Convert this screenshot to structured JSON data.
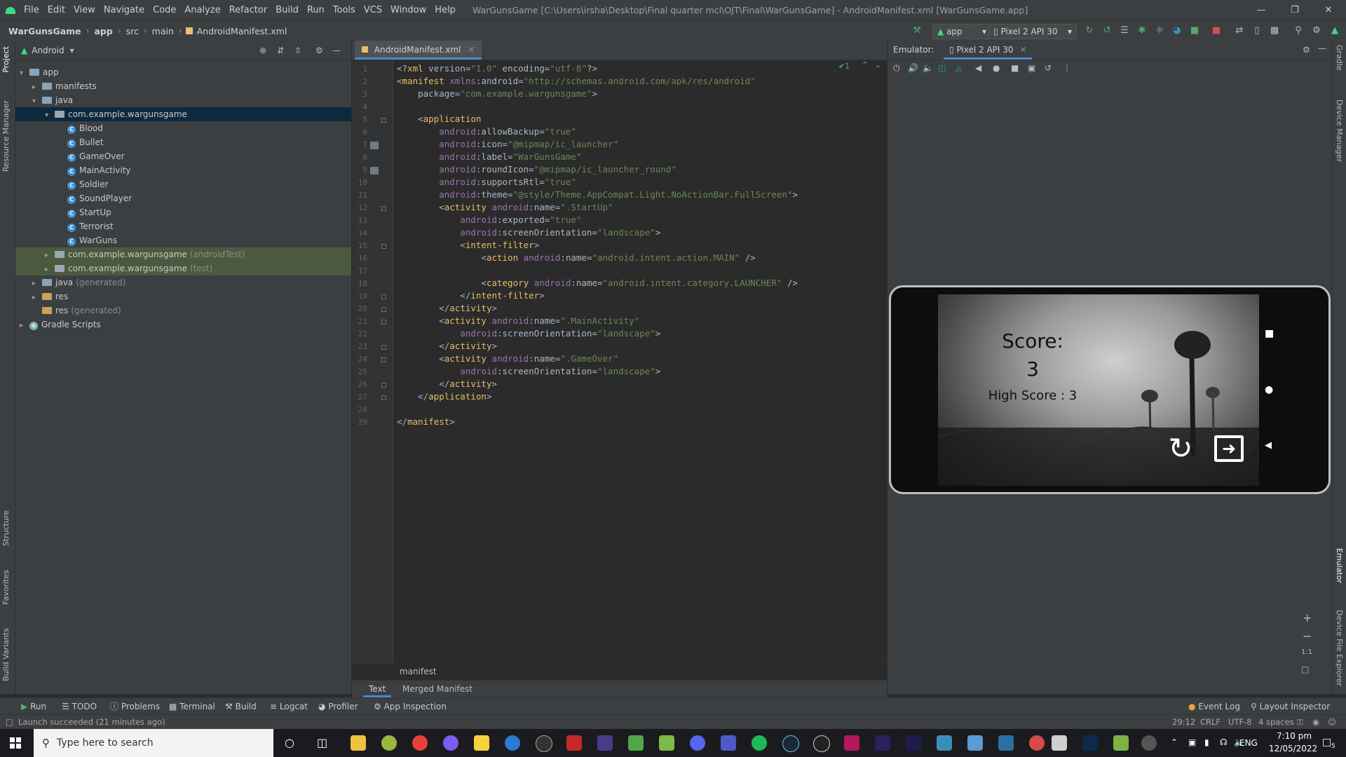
{
  "menu": [
    "File",
    "Edit",
    "View",
    "Navigate",
    "Code",
    "Analyze",
    "Refactor",
    "Build",
    "Run",
    "Tools",
    "VCS",
    "Window",
    "Help"
  ],
  "window_title": "WarGunsGame [C:\\Users\\irsha\\Desktop\\Final quarter mcl\\OJT\\Final\\WarGunsGame] - AndroidManifest.xml [WarGunsGame.app]",
  "breadcrumb": [
    "WarGunsGame",
    "app",
    "src",
    "main",
    "AndroidManifest.xml"
  ],
  "toolbar": {
    "config": "app",
    "device": "Pixel 2 API 30"
  },
  "project": {
    "view": "Android",
    "tree": [
      {
        "label": "app",
        "note": "",
        "depth": 0,
        "kind": "folder",
        "arrow": "▾"
      },
      {
        "label": "manifests",
        "note": "",
        "depth": 1,
        "kind": "folder",
        "arrow": "▸"
      },
      {
        "label": "java",
        "note": "",
        "depth": 1,
        "kind": "folder",
        "arrow": "▾"
      },
      {
        "label": "com.example.wargunsgame",
        "note": "",
        "depth": 2,
        "kind": "pkg",
        "arrow": "▾",
        "selected": true
      },
      {
        "label": "Blood",
        "note": "",
        "depth": 3,
        "kind": "class",
        "arrow": ""
      },
      {
        "label": "Bullet",
        "note": "",
        "depth": 3,
        "kind": "class",
        "arrow": ""
      },
      {
        "label": "GameOver",
        "note": "",
        "depth": 3,
        "kind": "class",
        "arrow": ""
      },
      {
        "label": "MainActivity",
        "note": "",
        "depth": 3,
        "kind": "class",
        "arrow": ""
      },
      {
        "label": "Soldier",
        "note": "",
        "depth": 3,
        "kind": "class",
        "arrow": ""
      },
      {
        "label": "SoundPlayer",
        "note": "",
        "depth": 3,
        "kind": "class",
        "arrow": ""
      },
      {
        "label": "StartUp",
        "note": "",
        "depth": 3,
        "kind": "class",
        "arrow": ""
      },
      {
        "label": "Terrorist",
        "note": "",
        "depth": 3,
        "kind": "class",
        "arrow": ""
      },
      {
        "label": "WarGuns",
        "note": "",
        "depth": 3,
        "kind": "class",
        "arrow": ""
      },
      {
        "label": "com.example.wargunsgame",
        "note": "(androidTest)",
        "depth": 2,
        "kind": "pkg",
        "arrow": "▸",
        "hl": true
      },
      {
        "label": "com.example.wargunsgame",
        "note": "(test)",
        "depth": 2,
        "kind": "pkg",
        "arrow": "▸",
        "hl": true
      },
      {
        "label": "java",
        "note": "(generated)",
        "depth": 1,
        "kind": "folder",
        "arrow": "▸"
      },
      {
        "label": "res",
        "note": "",
        "depth": 1,
        "kind": "res",
        "arrow": "▸"
      },
      {
        "label": "res",
        "note": "(generated)",
        "depth": 1,
        "kind": "res",
        "arrow": ""
      },
      {
        "label": "Gradle Scripts",
        "note": "",
        "depth": 0,
        "kind": "gradle",
        "arrow": "▸"
      }
    ]
  },
  "editor": {
    "tab": "AndroidManifest.xml",
    "inspection": "✔1",
    "code": [
      "<?xml version=\"1.0\" encoding=\"utf-8\"?>",
      "<manifest xmlns:android=\"http://schemas.android.com/apk/res/android\"",
      "    package=\"com.example.wargunsgame\">",
      "",
      "    <application",
      "        android:allowBackup=\"true\"",
      "        android:icon=\"@mipmap/ic_launcher\"",
      "        android:label=\"WarGunsGame\"",
      "        android:roundIcon=\"@mipmap/ic_launcher_round\"",
      "        android:supportsRtl=\"true\"",
      "        android:theme=\"@style/Theme.AppCompat.Light.NoActionBar.FullScreen\">",
      "        <activity android:name=\".StartUp\"",
      "            android:exported=\"true\"",
      "            android:screenOrientation=\"landscape\">",
      "            <intent-filter>",
      "                <action android:name=\"android.intent.action.MAIN\" />",
      "",
      "                <category android:name=\"android.intent.category.LAUNCHER\" />",
      "            </intent-filter>",
      "        </activity>",
      "        <activity android:name=\".MainActivity\"",
      "            android:screenOrientation=\"landscape\">",
      "        </activity>",
      "        <activity android:name=\".GameOver\"",
      "            android:screenOrientation=\"landscape\">",
      "        </activity>",
      "    </application>",
      "",
      "</manifest>"
    ],
    "breadcrumb": "manifest",
    "bottom_tabs": [
      "Text",
      "Merged Manifest"
    ]
  },
  "emulator": {
    "label": "Emulator:",
    "tab": "Pixel 2 API 30",
    "game": {
      "score_label": "Score:",
      "score": "3",
      "high_score": "High Score : 3"
    }
  },
  "left_tabs": [
    "Project",
    "Resource Manager",
    "Structure",
    "Favorites",
    "Build Variants"
  ],
  "right_tabs": [
    "Gradle",
    "Device Manager",
    "Emulator",
    "Device File Explorer"
  ],
  "tool_windows": [
    "Run",
    "TODO",
    "Problems",
    "Terminal",
    "Build",
    "Logcat",
    "Profiler",
    "App Inspection"
  ],
  "tool_windows_right": [
    "Event Log",
    "Layout Inspector"
  ],
  "status": {
    "message": "Launch succeeded (21 minutes ago)",
    "position": "29:12",
    "line_sep": "CRLF",
    "encoding": "UTF-8",
    "indent": "4 spaces"
  },
  "taskbar": {
    "search_placeholder": "Type here to search",
    "time": "7:10 pm",
    "date": "12/05/2022",
    "lang": "ENG",
    "notif": "5"
  },
  "colors": {
    "accent": "#4a88c7",
    "selection": "#0d293e",
    "android_green": "#3ddc84"
  }
}
